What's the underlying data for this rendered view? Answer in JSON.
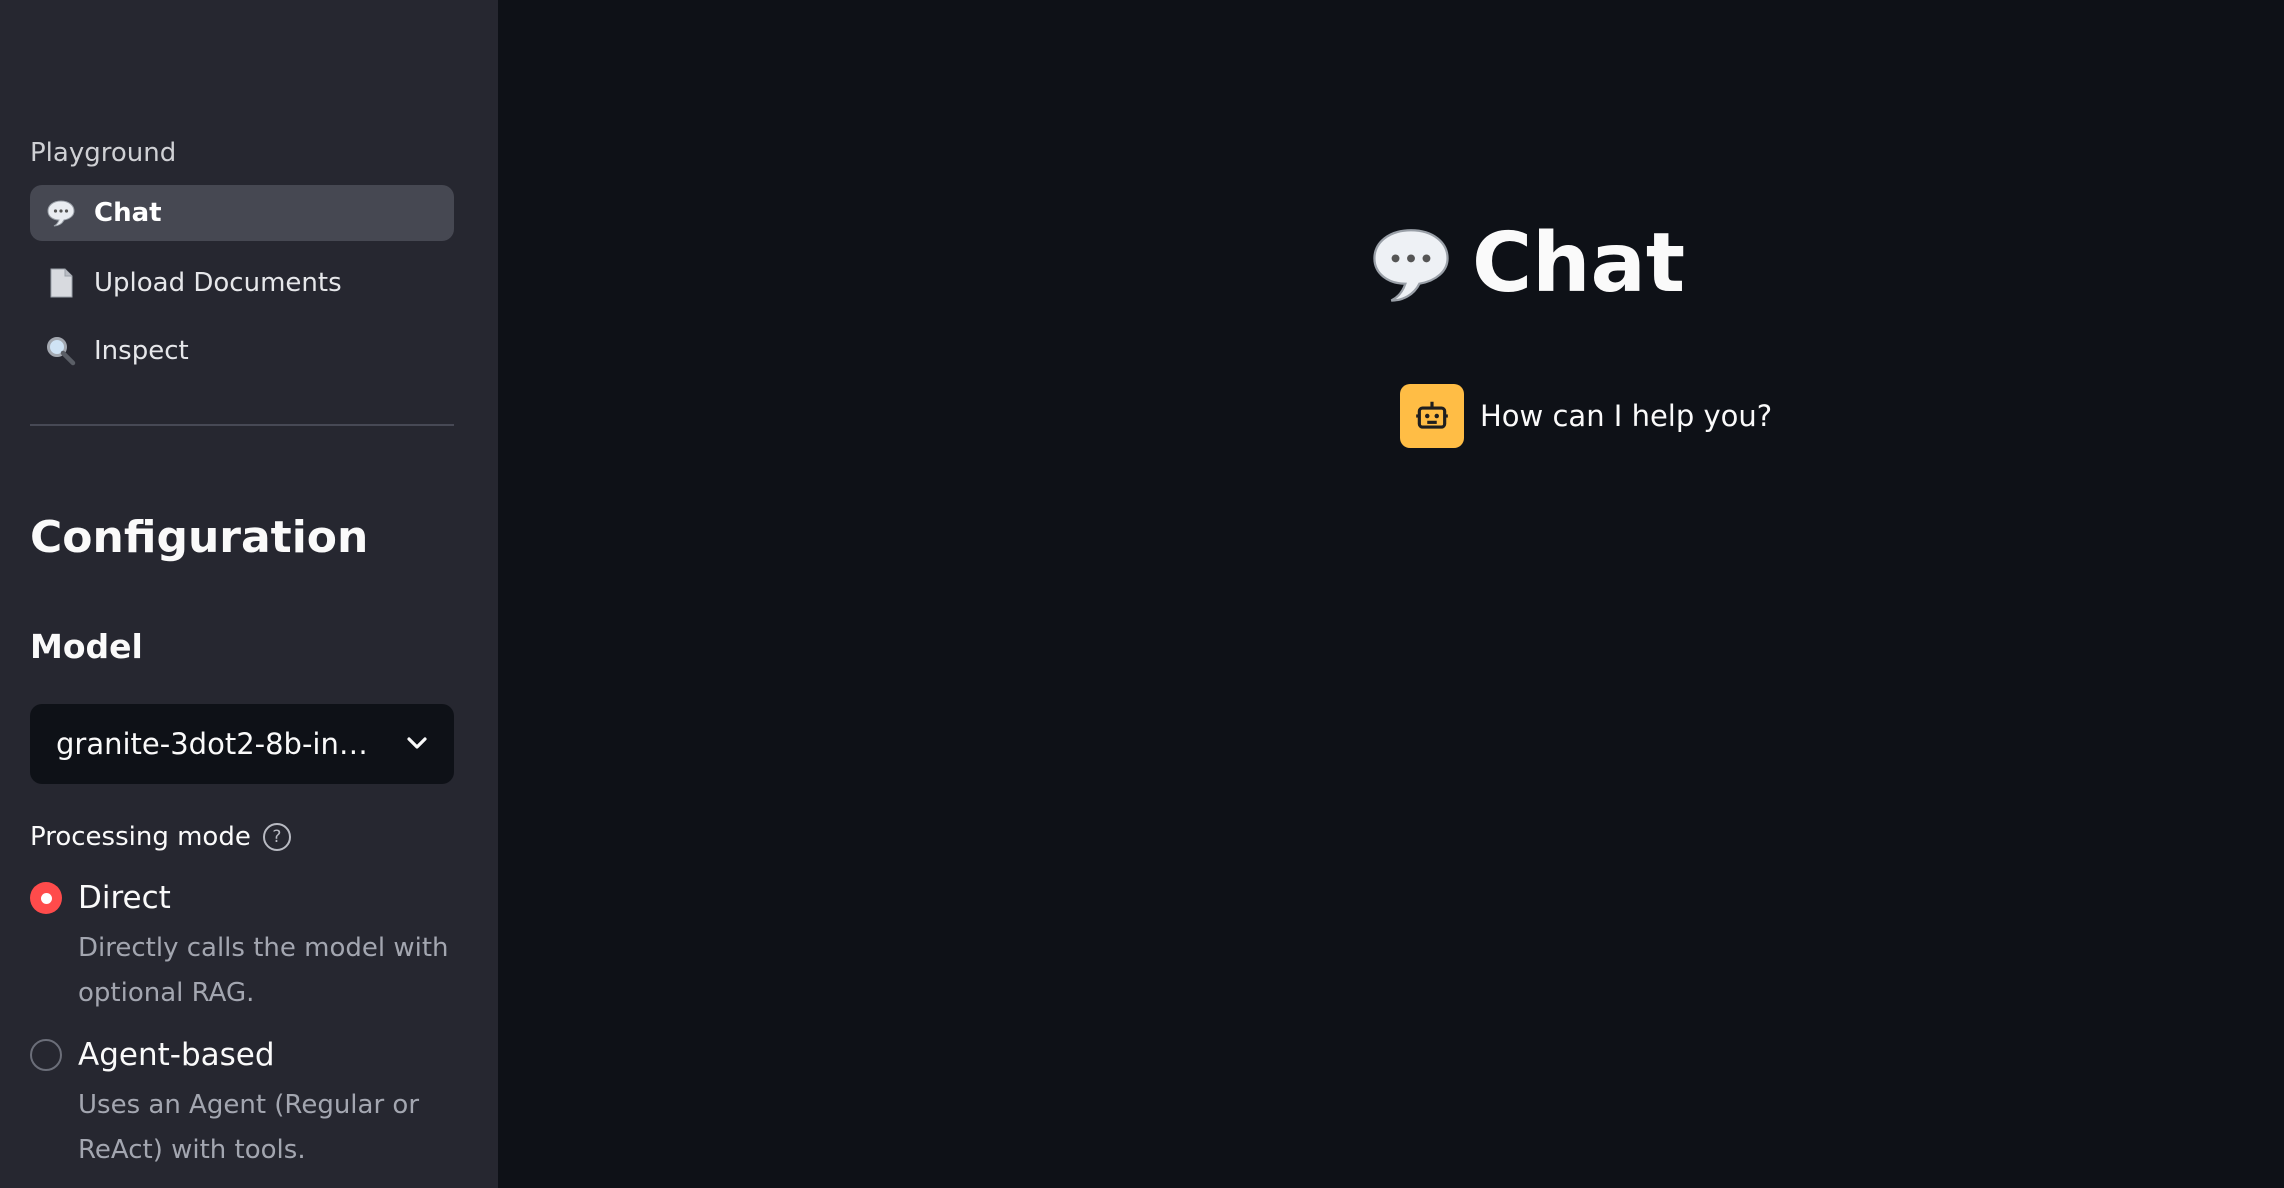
{
  "sidebar": {
    "section_label": "Playground",
    "nav_items": [
      {
        "label": "Chat",
        "icon": "speech-bubble-icon",
        "active": true
      },
      {
        "label": "Upload Documents",
        "icon": "document-icon",
        "active": false
      },
      {
        "label": "Inspect",
        "icon": "magnifier-icon",
        "active": false
      }
    ],
    "config_title": "Configuration",
    "model_title": "Model",
    "model_select": {
      "value": "granite-3dot2-8b-ins…",
      "icon": "chevron-down-icon"
    },
    "processing_mode": {
      "label": "Processing mode",
      "help_icon": "help-circle-icon",
      "options": [
        {
          "label": "Direct",
          "description": "Directly calls the model with optional RAG.",
          "checked": true
        },
        {
          "label": "Agent-based",
          "description": "Uses an Agent (Regular or ReAct) with tools.",
          "checked": false
        }
      ]
    }
  },
  "main": {
    "title": "Chat",
    "title_icon": "speech-bubble-icon",
    "messages": [
      {
        "role": "assistant",
        "avatar_icon": "robot-icon",
        "text": "How can I help you?"
      }
    ]
  },
  "colors": {
    "sidebar_bg": "#262730",
    "main_bg": "#0e1117",
    "accent": "#ff4b4b",
    "assistant_avatar": "#ffbd45"
  }
}
